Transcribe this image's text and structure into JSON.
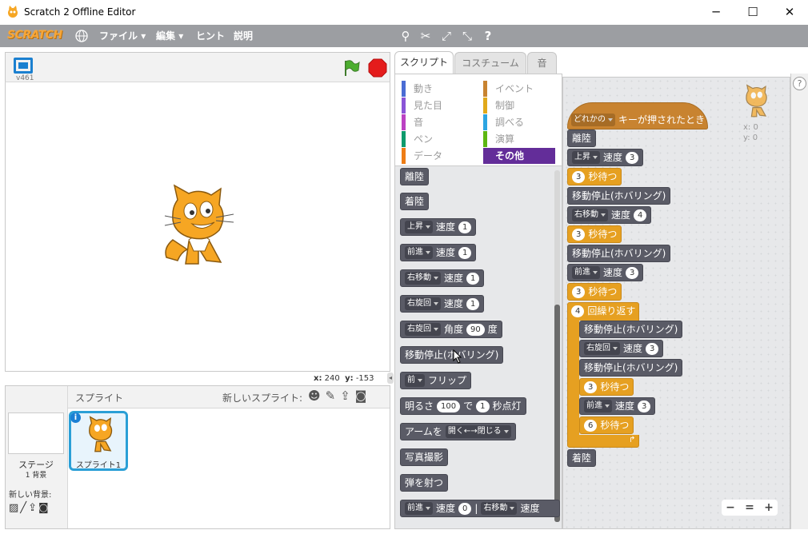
{
  "window": {
    "title": "Scratch 2 Offline Editor",
    "logo": "SCRATCH",
    "minimize": "─",
    "maximize": "☐",
    "close": "✕"
  },
  "menu": {
    "file": "ファイル",
    "edit": "編集",
    "tips": "ヒント",
    "about": "説明"
  },
  "stage": {
    "version": "v461",
    "x_label": "x:",
    "x_value": "240",
    "y_label": "y:",
    "y_value": "-153"
  },
  "sprites": {
    "header": "スプライト",
    "new_sprite": "新しいスプライト:",
    "stage_label": "ステージ",
    "backdrop_count": "1 背景",
    "new_backdrop": "新しい背景:",
    "sprite_name": "スプライト1"
  },
  "tabs": {
    "scripts": "スクリプト",
    "costumes": "コスチューム",
    "sounds": "音"
  },
  "categories": [
    {
      "label": "動き",
      "color": "#4a6cd4"
    },
    {
      "label": "イベント",
      "color": "#c88330"
    },
    {
      "label": "見た目",
      "color": "#8a55d7"
    },
    {
      "label": "制御",
      "color": "#e1a91a"
    },
    {
      "label": "音",
      "color": "#bb42c3"
    },
    {
      "label": "調べる",
      "color": "#2ca5e2"
    },
    {
      "label": "ペン",
      "color": "#0e9a6c"
    },
    {
      "label": "演算",
      "color": "#5cb712"
    },
    {
      "label": "データ",
      "color": "#ee7d16"
    },
    {
      "label": "その他",
      "color": "#632d99"
    }
  ],
  "palette": {
    "land": "着陸",
    "takeoff": "離陸",
    "up": "上昇",
    "forward": "前進",
    "right": "右移動",
    "rotate_right": "右旋回",
    "speed": "速度",
    "v1": "1",
    "angle": "角度",
    "v90": "90",
    "deg": "度",
    "hover": "移動停止(ホバリング)",
    "front": "前",
    "flip": "フリップ",
    "brightness": "明るさ",
    "v100": "100",
    "de": "で",
    "sec_blink": "秒点灯",
    "arm": "アームを",
    "open_close": "開く←→閉じる",
    "photo": "写真撮影",
    "shoot": "弾を射つ",
    "v0": "0",
    "bar": "|"
  },
  "script": {
    "hat_any": "どれかの",
    "hat_key": "キーが押されたとき",
    "takeoff": "離陸",
    "up": "上昇",
    "speed": "速度",
    "v3": "3",
    "wait": "秒待つ",
    "hover": "移動停止(ホバリング)",
    "right": "右移動",
    "v4": "4",
    "forward": "前進",
    "repeat_n": "4",
    "repeat": "回繰り返す",
    "rotate_right": "右旋回",
    "v6": "6",
    "land": "着陸",
    "x_label": "x: 0",
    "y_label": "y: 0"
  },
  "zoom": {
    "out": "−",
    "reset": "=",
    "in": "+"
  },
  "colors": {
    "more_blocks": "#5a5b66",
    "control": "#e6a021",
    "event": "#c88330",
    "selected_category": "#632d99"
  }
}
